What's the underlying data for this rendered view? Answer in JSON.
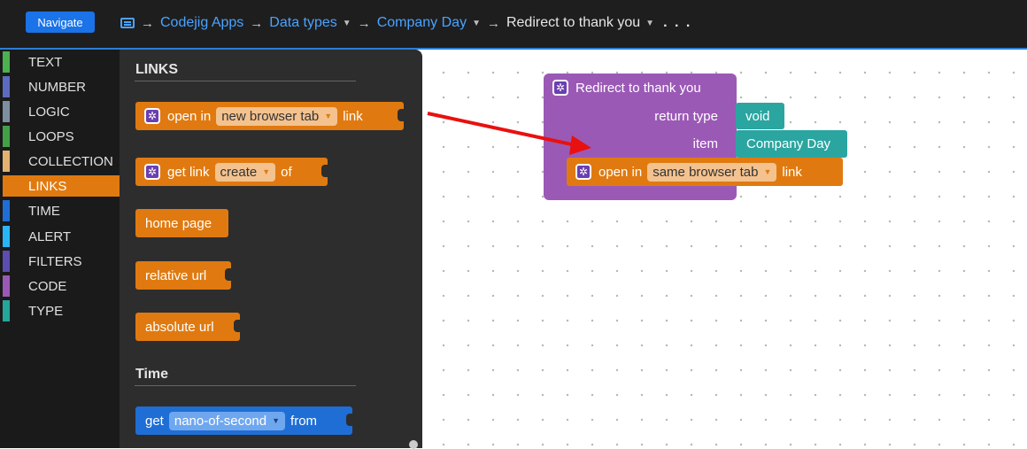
{
  "header": {
    "navigate_label": "Navigate",
    "breadcrumbs": [
      "Codejig Apps",
      "Data types",
      "Company Day",
      "Redirect to thank you"
    ],
    "more": ". . ."
  },
  "categories": [
    {
      "label": "TEXT",
      "color": "#4caf50"
    },
    {
      "label": "NUMBER",
      "color": "#5c6bc0"
    },
    {
      "label": "LOGIC",
      "color": "#7e8fa0"
    },
    {
      "label": "LOOPS",
      "color": "#43a047"
    },
    {
      "label": "COLLECTION",
      "color": "#e3b271"
    },
    {
      "label": "LINKS",
      "color": "#e07a10",
      "active": true
    },
    {
      "label": "TIME",
      "color": "#1f6ed6"
    },
    {
      "label": "ALERT",
      "color": "#29b6f6"
    },
    {
      "label": "FILTERS",
      "color": "#5c4db1"
    },
    {
      "label": "CODE",
      "color": "#9b59b6"
    },
    {
      "label": "TYPE",
      "color": "#26a69a"
    }
  ],
  "flyout": {
    "links_title": "LINKS",
    "time_title": "Time",
    "open_block": {
      "prefix": "open in",
      "option": "new browser tab",
      "suffix": "link"
    },
    "get_link_block": {
      "prefix": "get link",
      "option": "create",
      "suffix": "of"
    },
    "home_page": "home page",
    "relative_url": "relative url",
    "absolute_url": "absolute url",
    "time_block": {
      "prefix": "get",
      "option": "nano-of-second",
      "suffix": "from"
    }
  },
  "canvas": {
    "function_title": "Redirect to thank you",
    "return_type_label": "return type",
    "return_type_value": "void",
    "item_label": "item",
    "item_value": "Company Day",
    "open_block": {
      "prefix": "open in",
      "option": "same browser tab",
      "suffix": "link"
    }
  },
  "colors": {
    "accent": "#2b7fd6",
    "links_orange": "#e07a10",
    "function_purple": "#9b59b6",
    "type_teal": "#2ba5a0",
    "arrow_red": "#e8110f"
  }
}
